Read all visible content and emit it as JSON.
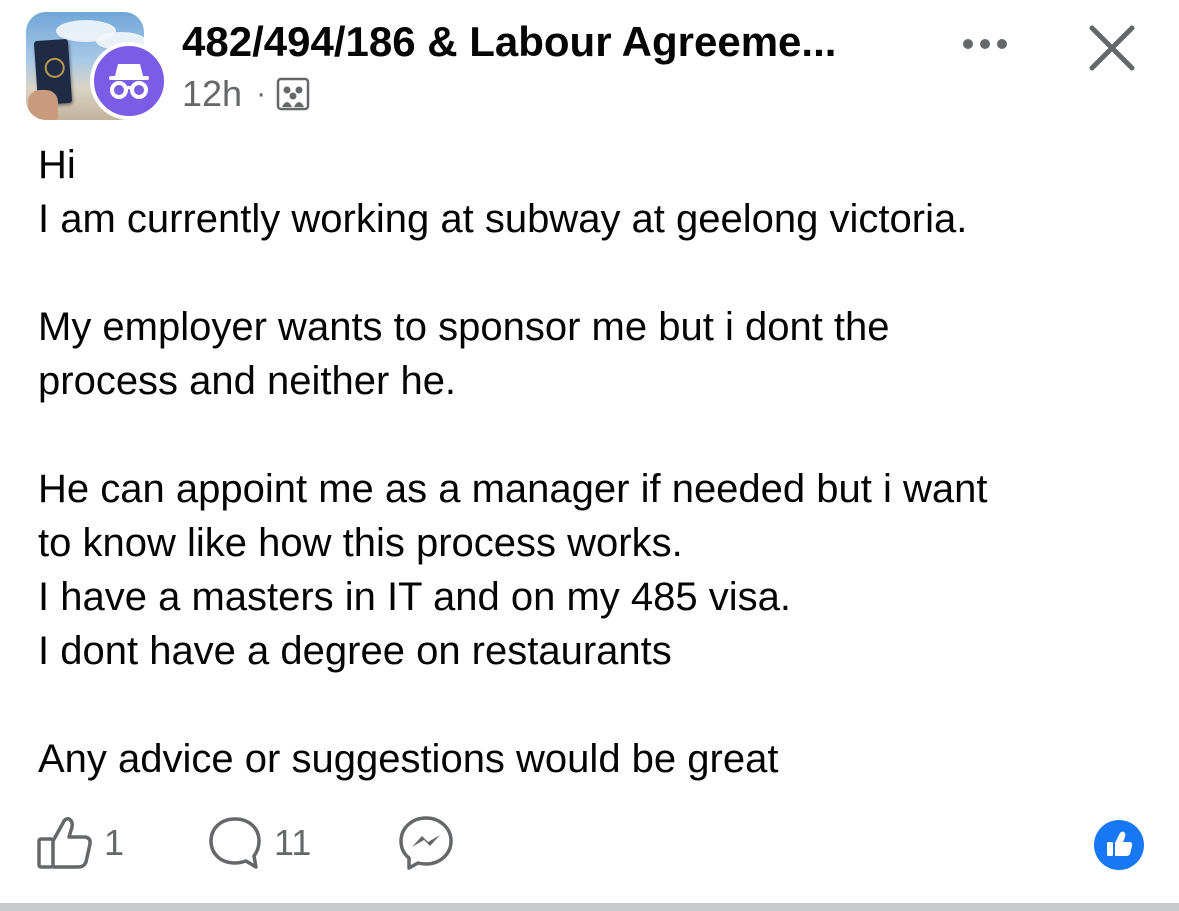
{
  "header": {
    "group_name": "482/494/186 & Labour Agreeme...",
    "timestamp": "12h",
    "separator": "·",
    "audience_icon": "group-members-icon",
    "avatar_icon": "anonymous-member-icon",
    "more_icon": "more-options-icon",
    "close_icon": "close-icon"
  },
  "post": {
    "paragraphs": [
      [
        "Hi",
        "I am currently working at subway at geelong victoria."
      ],
      [
        "My employer wants to sponsor me but i dont the",
        "process and neither he."
      ],
      [
        "He can appoint me as a manager if needed but i want",
        "to know like how this process works.",
        "I have a masters in IT and on my 485 visa.",
        "I dont have a degree on restaurants"
      ],
      [
        "Any advice or suggestions would be great"
      ]
    ]
  },
  "actions": {
    "like_icon": "thumbs-up-icon",
    "like_count": "1",
    "comment_icon": "comment-bubble-icon",
    "comment_count": "11",
    "share_icon": "messenger-icon",
    "reaction_icon": "like-reaction-icon"
  },
  "colors": {
    "text": "#050505",
    "secondary_text": "#65676b",
    "anon_purple": "#7b5ce6",
    "like_blue": "#1877f2"
  }
}
